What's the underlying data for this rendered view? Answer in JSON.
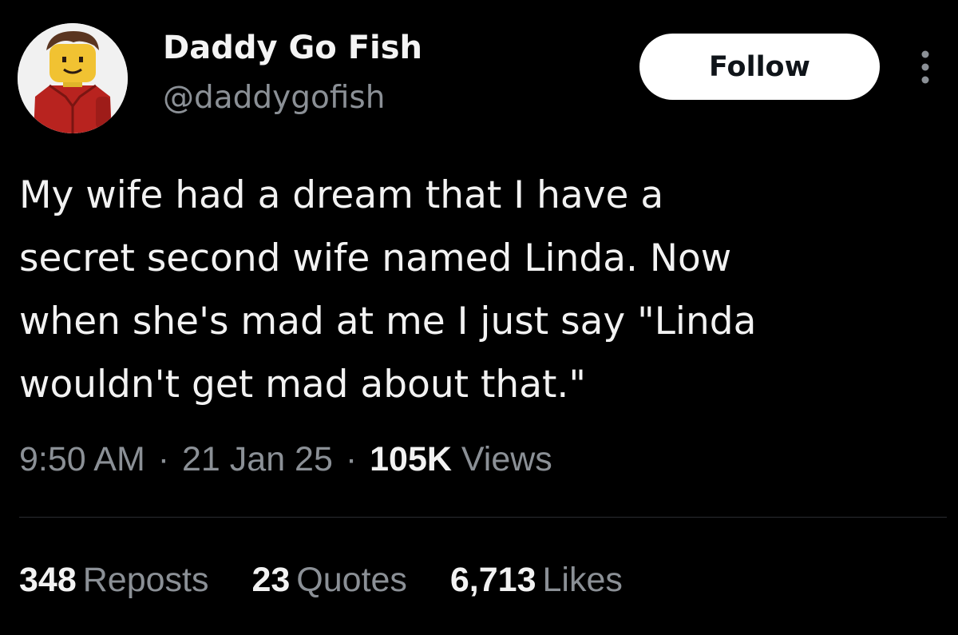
{
  "author": {
    "display_name": "Daddy Go Fish",
    "handle": "@daddygofish",
    "avatar_icon": "lego-minifigure-avatar"
  },
  "actions": {
    "follow_label": "Follow",
    "more_icon": "more-vertical-icon"
  },
  "tweet": {
    "lines": [
      "My wife had a dream that I have a",
      "secret second wife named Linda. Now",
      "when she's mad at me I just say \"Linda",
      "wouldn't get mad about that.\""
    ]
  },
  "meta": {
    "time": "9:50 AM",
    "date": "21 Jan 25",
    "separator": "·",
    "views_count": "105K",
    "views_label": "Views"
  },
  "stats": [
    {
      "count": "348",
      "label": "Reposts"
    },
    {
      "count": "23",
      "label": "Quotes"
    },
    {
      "count": "6,713",
      "label": "Likes"
    }
  ],
  "colors": {
    "background": "#000000",
    "primary_text": "#f2f2f2",
    "secondary_text": "#8b9096",
    "follow_bg": "#ffffff"
  }
}
